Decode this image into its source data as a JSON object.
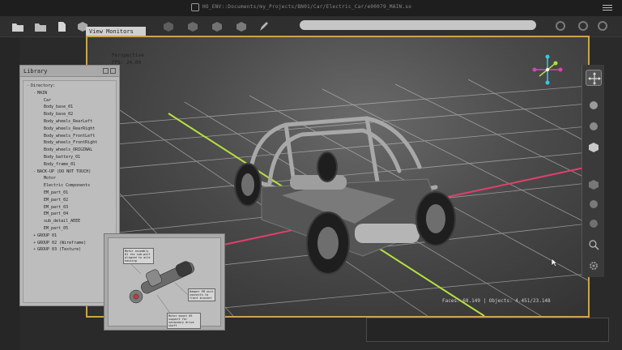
{
  "window": {
    "title": "HO_ENV::Documents/my_Projects/BN01/Car/Electric_Car/e00079_MAIN.so"
  },
  "viewport": {
    "tab_label": "View Monitors",
    "camera_label": "Perspective",
    "fps_label": "FPS: 24.00",
    "stats": "Faces: 68.149 | Objects: 4.451/23.148"
  },
  "library": {
    "title": "Library",
    "items": [
      {
        "label": "Directory:",
        "toggle": "-",
        "indent": 0
      },
      {
        "label": "MAIN",
        "toggle": "-",
        "indent": 1
      },
      {
        "label": "Car",
        "toggle": "",
        "indent": 2
      },
      {
        "label": "Body_base_01",
        "toggle": "",
        "indent": 2
      },
      {
        "label": "Body_base_02",
        "toggle": "",
        "indent": 2
      },
      {
        "label": "Body_wheels_RearLeft",
        "toggle": "",
        "indent": 2
      },
      {
        "label": "Body_wheels_RearRight",
        "toggle": "",
        "indent": 2
      },
      {
        "label": "Body_wheels_FrontLeft",
        "toggle": "",
        "indent": 2
      },
      {
        "label": "Body_wheels_FrontRight",
        "toggle": "",
        "indent": 2
      },
      {
        "label": "Body_wheels_ORIGINAL",
        "toggle": "",
        "indent": 2
      },
      {
        "label": "Body_battery_01",
        "toggle": "",
        "indent": 2
      },
      {
        "label": "Body_frame_01",
        "toggle": "",
        "indent": 2
      },
      {
        "label": "BACK-UP (DO NOT TOUCH)",
        "toggle": "-",
        "indent": 1
      },
      {
        "label": "Motor",
        "toggle": "",
        "indent": 2
      },
      {
        "label": "Electric Components",
        "toggle": "",
        "indent": 2
      },
      {
        "label": "EM_part_01",
        "toggle": "",
        "indent": 2
      },
      {
        "label": "EM_part_02",
        "toggle": "",
        "indent": 2
      },
      {
        "label": "EM_part_03",
        "toggle": "",
        "indent": 2
      },
      {
        "label": "EM_part_04",
        "toggle": "",
        "indent": 2
      },
      {
        "label": "sub_detail_AEEE",
        "toggle": "",
        "indent": 2
      },
      {
        "label": "EM_part_05",
        "toggle": "",
        "indent": 2
      },
      {
        "label": "GROUP 01",
        "toggle": "+",
        "indent": 1
      },
      {
        "label": "GROUP 02 (Wireframe)",
        "toggle": "+",
        "indent": 1
      },
      {
        "label": "GROUP 03 (Texture)",
        "toggle": "+",
        "indent": 1
      }
    ]
  },
  "popup": {
    "note_top": "Motor assembly 01 rev sub-part aligned to axle housing",
    "note_mid": "Damper EM unit connects to front bracket",
    "note_bottom": "Motor mount 05 support for secondary drive shaft"
  },
  "colors": {
    "viewport_border": "#c9a64a",
    "axis_x": "#e0406a",
    "axis_y": "#b8e040",
    "gizmo_cyan": "#38c8e8",
    "gizmo_magenta": "#e040b0",
    "gizmo_lime": "#b0e040"
  },
  "icons": {
    "toolbar": [
      "folder-icon",
      "folder-icon",
      "file-icon",
      "cube-icon",
      "cube-icon",
      "cube-icon",
      "cube-icon",
      "pen-icon"
    ],
    "tool_strip": [
      "move-icon",
      "sphere-icon",
      "sphere-icon",
      "cube-icon",
      "cube-icon",
      "sphere-icon",
      "sphere-icon",
      "zoom-icon",
      "gear-icon"
    ]
  }
}
